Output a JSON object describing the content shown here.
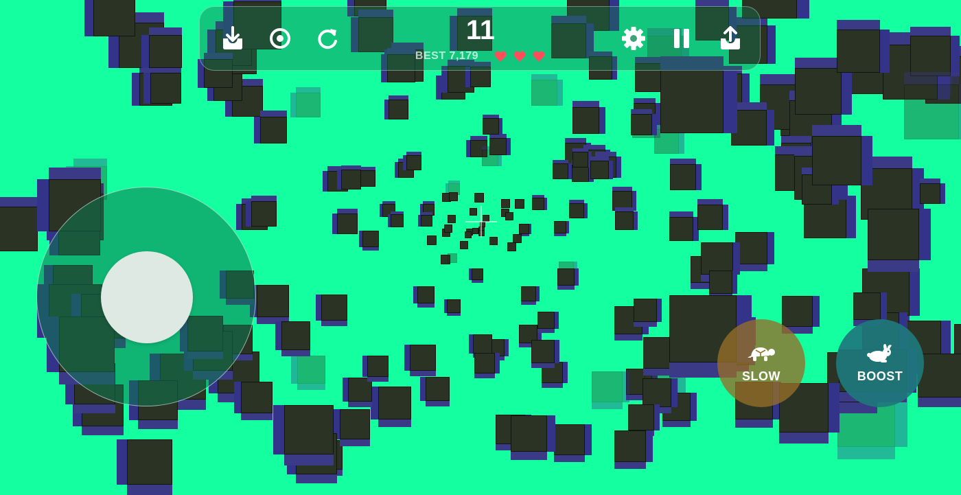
{
  "hud": {
    "score": "11",
    "best": "BEST 7,179",
    "lives": 3
  },
  "buttons": {
    "slow_label": "SLOW",
    "boost_label": "BOOST"
  },
  "icons": {
    "download": "download-tray-icon",
    "target": "target-icon",
    "restart": "restart-arrow-icon",
    "settings": "gear-icon",
    "pause": "pause-icon",
    "share": "upload-tray-icon",
    "heart": "heart-icon",
    "slow": "turtle-icon",
    "boost": "rabbit-icon"
  },
  "colors": {
    "background": "#14ff9f",
    "heart": "#ff4d5a",
    "slow_button": "#96702a",
    "boost_button": "#1e787d"
  }
}
